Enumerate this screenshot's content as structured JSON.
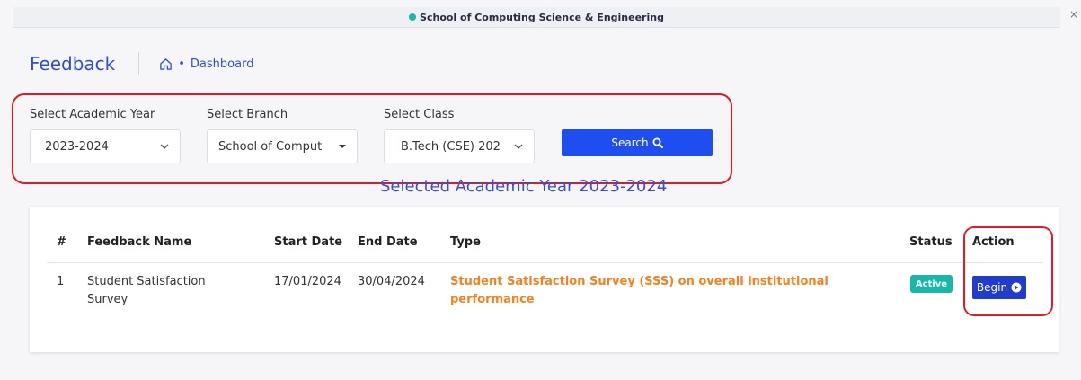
{
  "topbar": {
    "school": "School of Computing Science & Engineering",
    "dot_color": "#18b7a8",
    "close": "×"
  },
  "header": {
    "title": "Feedback",
    "breadcrumb_bullet": "•",
    "breadcrumb": "Dashboard"
  },
  "filters": {
    "academic_year": {
      "label": "Select Academic Year",
      "value": "2023-2024"
    },
    "branch": {
      "label": "Select Branch",
      "value": "School of Comput"
    },
    "class": {
      "label": "Select Class",
      "value": "B.Tech (CSE) 202"
    },
    "search_label": "Search"
  },
  "selected_year_text": "Selected Academic Year 2023-2024",
  "table": {
    "headers": {
      "index": "#",
      "name": "Feedback Name",
      "start": "Start Date",
      "end": "End Date",
      "type": "Type",
      "status": "Status",
      "action": "Action"
    },
    "rows": [
      {
        "index": "1",
        "name": "Student Satisfaction Survey",
        "start": "17/01/2024",
        "end": "30/04/2024",
        "type": "Student Satisfaction Survey (SSS) on overall institutional performance",
        "status": "Active",
        "action": "Begin"
      }
    ]
  },
  "colors": {
    "accent": "#1f4ef0",
    "title": "#2d4dd8",
    "type_text": "#f58220",
    "status_active": "#18b7a8",
    "highlight_box": "#e01b24"
  },
  "icons": {
    "home": "home-icon",
    "search": "search-icon",
    "play": "play-circle-icon",
    "chevron": "chevron-down-icon"
  }
}
